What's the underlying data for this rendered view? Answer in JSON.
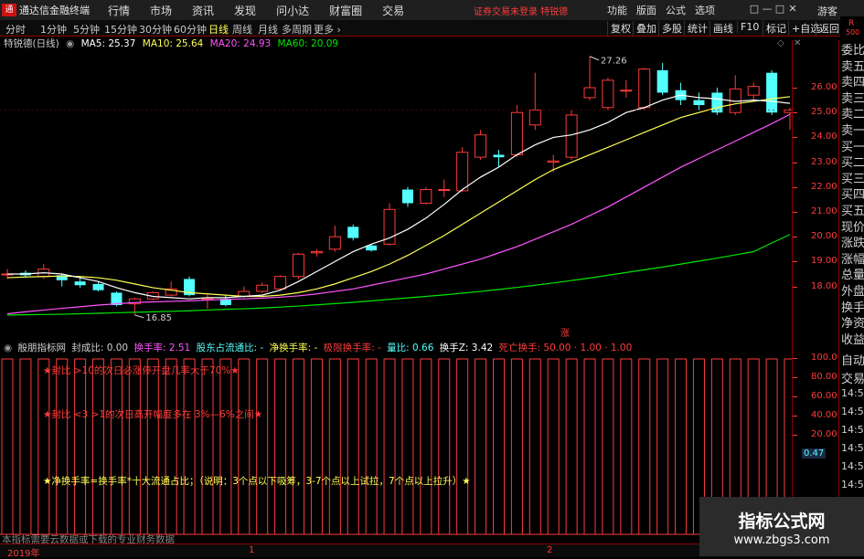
{
  "titlebar": {
    "app_title": "通达信金融终端",
    "menu": [
      "行情",
      "市场",
      "资讯",
      "发现",
      "问小达",
      "财富圈",
      "交易"
    ],
    "status": "证券交易未登录  特锐德",
    "right_menu": [
      "功能",
      "版面",
      "公式",
      "选项"
    ],
    "guest": "游客",
    "win_controls": [
      "□",
      "—",
      "□",
      "✕"
    ]
  },
  "toolbar": {
    "periods": [
      "分时",
      "1分钟",
      "5分钟",
      "15分钟",
      "30分钟",
      "60分钟",
      "日线",
      "周线",
      "月线",
      "多周期",
      "更多 ›"
    ],
    "active_period": "日线",
    "buttons": [
      "复权",
      "叠加",
      "多股",
      "统计",
      "画线",
      "F10",
      "标记",
      "+自选",
      "返回"
    ],
    "corner_r": "R",
    "corner_500": "500"
  },
  "ma_line": {
    "stock": "特锐德(日线)",
    "ma5": "MA5: 25.37",
    "ma10": "MA10: 25.64",
    "ma20": "MA20: 24.93",
    "ma60": "MA60: 20.09"
  },
  "chart_data": {
    "type": "candlestick",
    "series_name": "特锐德(日线)",
    "y_axis": {
      "ticks": [
        "26.00",
        "25.00",
        "24.00",
        "23.00",
        "22.00",
        "21.00",
        "20.00",
        "19.00",
        "18.00"
      ],
      "range": [
        17.0,
        27.9
      ]
    },
    "high_label": "27.26",
    "low_label": "16.85",
    "candles": [
      {
        "o": 18.5,
        "c": 18.5,
        "h": 18.7,
        "l": 18.3
      },
      {
        "o": 18.55,
        "c": 18.45,
        "h": 18.65,
        "l": 18.35
      },
      {
        "o": 18.4,
        "c": 18.7,
        "h": 18.9,
        "l": 18.3
      },
      {
        "o": 18.45,
        "c": 18.25,
        "h": 18.5,
        "l": 18.0
      },
      {
        "o": 18.2,
        "c": 18.05,
        "h": 18.35,
        "l": 17.95
      },
      {
        "o": 18.1,
        "c": 17.85,
        "h": 18.2,
        "l": 17.8
      },
      {
        "o": 17.75,
        "c": 17.25,
        "h": 17.8,
        "l": 17.2
      },
      {
        "o": 17.3,
        "c": 17.5,
        "h": 17.55,
        "l": 16.85
      },
      {
        "o": 17.5,
        "c": 17.75,
        "h": 17.8,
        "l": 17.45
      },
      {
        "o": 17.65,
        "c": 17.9,
        "h": 18.2,
        "l": 17.6
      },
      {
        "o": 18.3,
        "c": 17.65,
        "h": 18.4,
        "l": 17.6
      },
      {
        "o": 17.5,
        "c": 17.5,
        "h": 17.7,
        "l": 17.1
      },
      {
        "o": 17.5,
        "c": 17.25,
        "h": 17.65,
        "l": 17.2
      },
      {
        "o": 17.6,
        "c": 17.8,
        "h": 18.0,
        "l": 17.55
      },
      {
        "o": 17.8,
        "c": 18.05,
        "h": 18.15,
        "l": 17.75
      },
      {
        "o": 17.9,
        "c": 18.4,
        "h": 18.45,
        "l": 17.85
      },
      {
        "o": 18.4,
        "c": 19.3,
        "h": 19.35,
        "l": 18.3
      },
      {
        "o": 19.35,
        "c": 19.4,
        "h": 19.5,
        "l": 19.2
      },
      {
        "o": 19.5,
        "c": 20.0,
        "h": 20.45,
        "l": 19.4
      },
      {
        "o": 20.4,
        "c": 19.95,
        "h": 20.5,
        "l": 19.85
      },
      {
        "o": 19.65,
        "c": 19.45,
        "h": 19.7,
        "l": 19.4
      },
      {
        "o": 19.7,
        "c": 21.1,
        "h": 21.35,
        "l": 19.65
      },
      {
        "o": 21.9,
        "c": 21.35,
        "h": 22.0,
        "l": 21.2
      },
      {
        "o": 21.35,
        "c": 21.9,
        "h": 22.0,
        "l": 21.3
      },
      {
        "o": 21.9,
        "c": 21.9,
        "h": 22.3,
        "l": 21.6
      },
      {
        "o": 21.85,
        "c": 23.4,
        "h": 23.6,
        "l": 21.8
      },
      {
        "o": 23.2,
        "c": 24.1,
        "h": 24.3,
        "l": 23.1
      },
      {
        "o": 23.3,
        "c": 23.2,
        "h": 23.5,
        "l": 22.8
      },
      {
        "o": 23.3,
        "c": 25.0,
        "h": 25.3,
        "l": 23.2
      },
      {
        "o": 24.5,
        "c": 25.1,
        "h": 26.6,
        "l": 24.3
      },
      {
        "o": 23.0,
        "c": 23.05,
        "h": 23.3,
        "l": 22.6
      },
      {
        "o": 23.2,
        "c": 24.9,
        "h": 25.1,
        "l": 23.1
      },
      {
        "o": 25.6,
        "c": 26.0,
        "h": 27.26,
        "l": 25.5
      },
      {
        "o": 25.2,
        "c": 26.3,
        "h": 26.4,
        "l": 25.1
      },
      {
        "o": 25.9,
        "c": 25.9,
        "h": 26.3,
        "l": 25.6
      },
      {
        "o": 25.2,
        "c": 26.75,
        "h": 26.8,
        "l": 25.1
      },
      {
        "o": 26.7,
        "c": 25.8,
        "h": 27.0,
        "l": 25.7
      },
      {
        "o": 25.9,
        "c": 25.5,
        "h": 26.2,
        "l": 25.3
      },
      {
        "o": 25.5,
        "c": 25.3,
        "h": 25.8,
        "l": 25.1
      },
      {
        "o": 25.8,
        "c": 25.0,
        "h": 26.0,
        "l": 24.9
      },
      {
        "o": 25.0,
        "c": 25.95,
        "h": 26.5,
        "l": 24.9
      },
      {
        "o": 25.7,
        "c": 26.05,
        "h": 26.2,
        "l": 25.5
      },
      {
        "o": 26.6,
        "c": 25.0,
        "h": 26.7,
        "l": 24.9
      },
      {
        "o": 25.0,
        "c": 25.1,
        "h": 25.2,
        "l": 24.3
      }
    ],
    "ma5": [
      18.5,
      18.5,
      18.55,
      18.5,
      18.35,
      18.2,
      17.95,
      17.75,
      17.6,
      17.55,
      17.5,
      17.55,
      17.55,
      17.6,
      17.65,
      17.85,
      18.2,
      18.6,
      19.0,
      19.4,
      19.7,
      19.95,
      20.3,
      20.75,
      21.3,
      21.9,
      22.4,
      22.8,
      23.3,
      23.7,
      24.0,
      24.1,
      24.3,
      24.6,
      25.0,
      25.2,
      25.5,
      25.7,
      25.6,
      25.55,
      25.45,
      25.5,
      25.45,
      25.37
    ],
    "ma10": [
      18.35,
      18.38,
      18.4,
      18.42,
      18.4,
      18.35,
      18.25,
      18.1,
      17.95,
      17.85,
      17.75,
      17.7,
      17.65,
      17.6,
      17.6,
      17.65,
      17.75,
      17.9,
      18.1,
      18.35,
      18.6,
      18.9,
      19.25,
      19.65,
      20.05,
      20.5,
      20.95,
      21.4,
      21.85,
      22.3,
      22.7,
      23.0,
      23.3,
      23.6,
      23.9,
      24.2,
      24.5,
      24.8,
      25.0,
      25.2,
      25.35,
      25.45,
      25.55,
      25.64
    ],
    "ma20": [
      16.9,
      16.98,
      17.05,
      17.12,
      17.18,
      17.25,
      17.3,
      17.35,
      17.38,
      17.4,
      17.42,
      17.45,
      17.48,
      17.5,
      17.53,
      17.57,
      17.62,
      17.7,
      17.8,
      17.9,
      18.05,
      18.2,
      18.35,
      18.5,
      18.7,
      18.9,
      19.1,
      19.35,
      19.6,
      19.9,
      20.2,
      20.5,
      20.85,
      21.2,
      21.6,
      22.0,
      22.4,
      22.8,
      23.15,
      23.5,
      23.85,
      24.2,
      24.55,
      24.93
    ],
    "ma60": [
      16.85,
      16.86,
      16.87,
      16.88,
      16.9,
      16.92,
      16.94,
      16.96,
      16.98,
      17.0,
      17.02,
      17.05,
      17.08,
      17.1,
      17.13,
      17.17,
      17.21,
      17.26,
      17.31,
      17.36,
      17.42,
      17.48,
      17.54,
      17.6,
      17.66,
      17.73,
      17.8,
      17.88,
      17.96,
      18.05,
      18.14,
      18.24,
      18.34,
      18.45,
      18.56,
      18.67,
      18.78,
      18.9,
      19.02,
      19.14,
      19.27,
      19.4,
      19.75,
      20.09
    ]
  },
  "marker_zhang": "涨",
  "colors": {
    "up": "#ff3b3b",
    "down": "#54ffff",
    "ma5": "#ffffff",
    "ma10": "#ffff54",
    "ma20": "#ff54ff",
    "ma60": "#00e600",
    "axis": "#ff3b3b",
    "border": "#8b0000"
  },
  "right_panel": [
    "委比",
    "卖五",
    "卖四",
    "卖三",
    "卖二",
    "卖一",
    "买一",
    "买二",
    "买三",
    "买四",
    "买五",
    "现价",
    "涨跌",
    "涨幅",
    "总量",
    "外盘",
    "换手",
    "净资",
    "收益"
  ],
  "right_panel2": [
    "自动",
    "交易",
    "14:5",
    "14:5",
    "14:5",
    "14:5",
    "14:5",
    "14:5",
    "14:5",
    "14:5"
  ],
  "indicator_bar": {
    "name": "殷朋指标网",
    "fcb": "封成比: 0.00",
    "hsl": "换手率: 2.51",
    "gdz": "股东占流通比: -",
    "jhs": "净换手率: -",
    "jbhs": "极限换手率: -",
    "lb": "量比: 0.66",
    "hsz": "换手Z: 3.42",
    "swhs": "死亡换手: 50.00 · 1.00 · 1.00"
  },
  "indicator_axis": {
    "ticks": [
      "100.0",
      "80.00",
      "60.00",
      "40.00",
      "20.00",
      "0.47"
    ],
    "value_box": "0.47"
  },
  "indicator_bars": [
    100,
    100,
    100,
    100,
    100,
    100,
    100,
    100,
    100,
    100,
    100,
    100,
    100,
    100,
    100,
    100,
    100,
    100,
    100,
    100,
    100,
    100,
    100,
    100,
    100,
    100,
    100,
    100,
    100,
    100,
    100,
    100,
    100,
    100,
    100,
    100,
    100,
    100,
    100,
    100,
    100,
    100,
    100,
    100
  ],
  "notes": {
    "n1": "★封比 >10的次日必涨停开盘几率大于70%★",
    "n2": "★封比 <3 >1的次日高开幅度多在 3%—6%之间★",
    "n3": "★净换手率=换手率*十大流通占比；（说明：3个点以下吸筹，3-7个点以上试拉，7个点以上拉升）★",
    "n4": "本指标需要云数据或下载的专业财务数据"
  },
  "bottom_axis": {
    "year": "2019年",
    "m1": "1",
    "m2": "2"
  },
  "brand": {
    "line1": "指标公式网",
    "line2": "www.zbgs3.com"
  }
}
